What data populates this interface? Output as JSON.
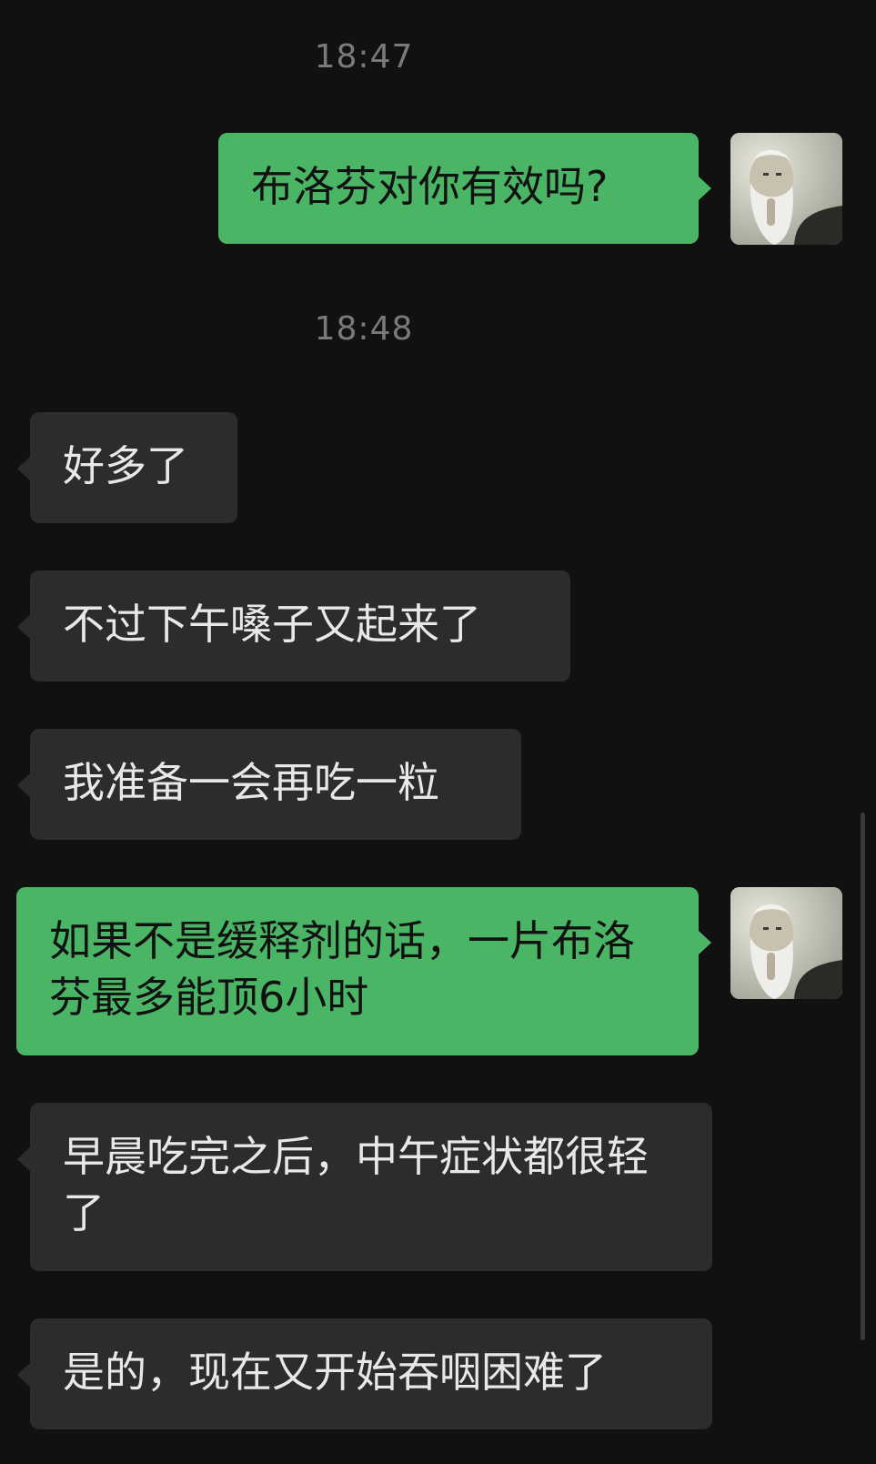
{
  "chat": {
    "timestamps": [
      "18:47",
      "18:48"
    ],
    "messages": [
      {
        "direction": "outgoing",
        "text": "布洛芬对你有效吗?"
      },
      {
        "direction": "incoming",
        "text": "好多了"
      },
      {
        "direction": "incoming",
        "text": "不过下午嗓子又起来了"
      },
      {
        "direction": "incoming",
        "text": "我准备一会再吃一粒"
      },
      {
        "direction": "outgoing",
        "text": "如果不是缓释剂的话，一片布洛芬最多能顶6小时"
      },
      {
        "direction": "incoming",
        "text": "早晨吃完之后，中午症状都很轻了"
      },
      {
        "direction": "incoming",
        "text": "是的，现在又开始吞咽困难了"
      }
    ]
  },
  "colors": {
    "background": "#111111",
    "incoming_bubble": "#2c2c2c",
    "outgoing_bubble": "#4bb566",
    "timestamp_text": "#7a7a7a"
  },
  "icons": {
    "avatar": "user-avatar-photo"
  }
}
